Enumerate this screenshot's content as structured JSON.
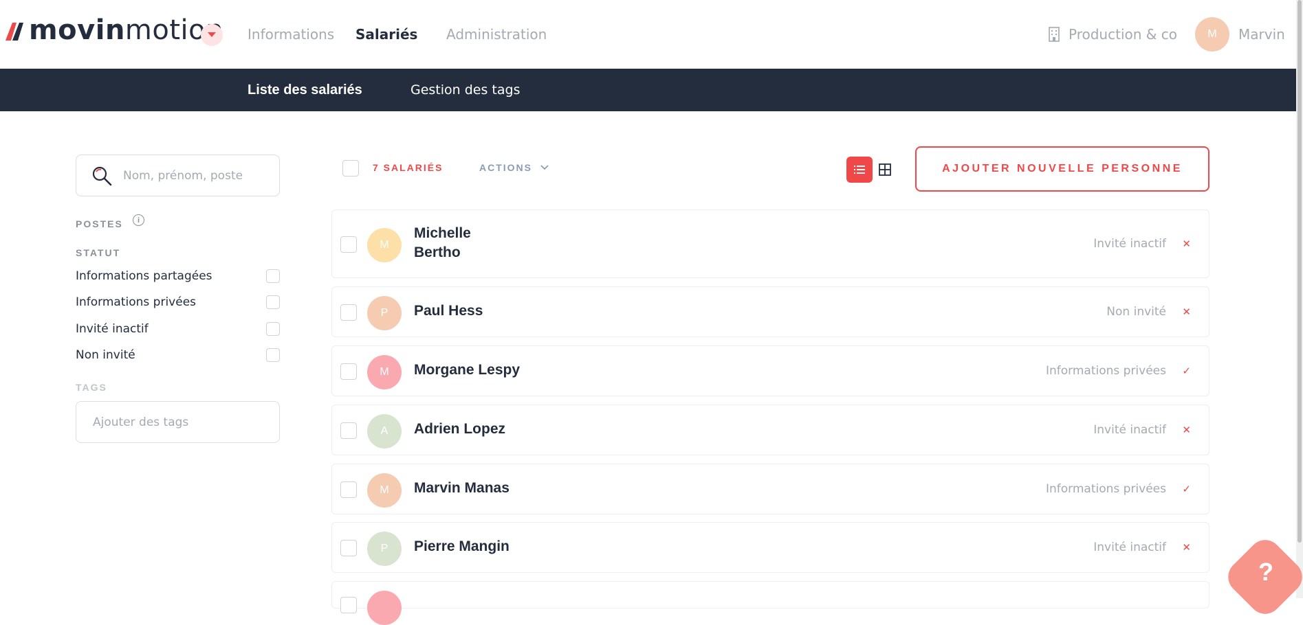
{
  "brand": {
    "logo_bold": "movin",
    "logo_light": "motion",
    "logo_text": "movinmotion"
  },
  "nav": {
    "items": [
      {
        "label": "Informations",
        "active": false
      },
      {
        "label": "Salariés",
        "active": true
      },
      {
        "label": "Administration",
        "active": false
      }
    ]
  },
  "account": {
    "company": "Production & co",
    "user_initial": "M",
    "user_name": "Marvin"
  },
  "subnav": {
    "items": [
      {
        "label": "Liste des salariés",
        "active": true
      },
      {
        "label": "Gestion des tags",
        "active": false
      }
    ]
  },
  "search": {
    "placeholder": "Nom, prénom, poste"
  },
  "filters": {
    "postes_title": "POSTES",
    "statut_title": "STATUT",
    "statut_options": [
      "Informations partagées",
      "Informations privées",
      "Invité inactif",
      "Non invité"
    ],
    "tags_title": "TAGS",
    "tags_placeholder": "Ajouter des tags"
  },
  "toolbar": {
    "count_label": "7 SALARIÉS",
    "actions_label": "ACTIONS",
    "add_label": "AJOUTER NOUVELLE PERSONNE"
  },
  "employees": [
    {
      "first": "Michelle",
      "last": "Bertho",
      "name": "Michelle Bertho",
      "initial": "M",
      "color": "#fde0a8",
      "status": "Invité inactif",
      "mark": "✕"
    },
    {
      "name": "Paul Hess",
      "initial": "P",
      "color": "#f5cbb2",
      "status": "Non invité",
      "mark": "✕"
    },
    {
      "name": "Morgane Lespy",
      "initial": "M",
      "color": "#fba9b0",
      "status": "Informations privées",
      "mark": "✓"
    },
    {
      "name": "Adrien Lopez",
      "initial": "A",
      "color": "#d8e4cf",
      "status": "Invité inactif",
      "mark": "✕"
    },
    {
      "name": "Marvin Manas",
      "initial": "M",
      "color": "#f5cbb2",
      "status": "Informations privées",
      "mark": "✓"
    },
    {
      "name": "Pierre Mangin",
      "initial": "P",
      "color": "#d8e4cf",
      "status": "Invité inactif",
      "mark": "✕"
    }
  ],
  "colors": {
    "accent": "#f04848",
    "navy": "#232d3d",
    "muted": "#a4a9b2"
  },
  "icons": {
    "search": "search-icon",
    "info": "info-icon",
    "list": "list-view-icon",
    "grid": "grid-view-icon",
    "building": "building-icon",
    "help": "help-icon"
  },
  "help": {
    "label": "?"
  }
}
